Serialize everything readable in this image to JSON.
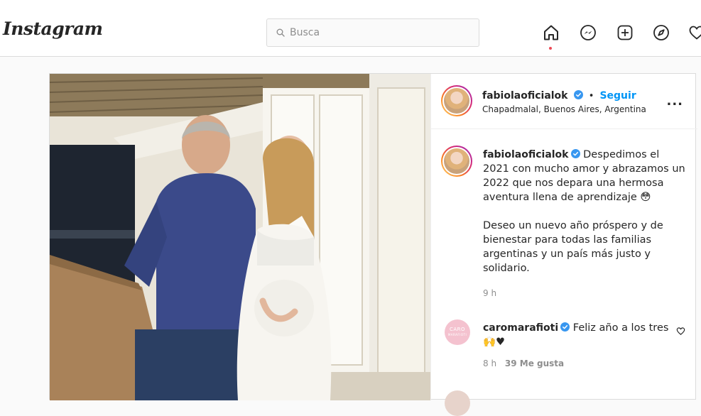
{
  "app": {
    "logo": "Instagram"
  },
  "search": {
    "placeholder": "Busca"
  },
  "nav": {
    "icons": [
      "home-icon",
      "messenger-icon",
      "new-post-icon",
      "explore-icon",
      "activity-heart-icon"
    ]
  },
  "post": {
    "author": {
      "username": "fabiolaoficialok",
      "separator": "•",
      "follow_label": "Seguir",
      "location": "Chapadmalal, Buenos Aires, Argentina"
    },
    "more_label": "...",
    "caption": {
      "username": "fabiolaoficialok",
      "paragraph1": "Despedimos el 2021 con mucho amor y abrazamos un 2022 que nos depara una hermosa aventura llena de aprendizaje 😳",
      "paragraph2": "Deseo un nuevo año próspero y de bienestar para todas las familias argentinas y un país más justo y solidario.",
      "time": "9 h"
    },
    "comments": [
      {
        "username": "caromarafioti",
        "avatar_text_top": "CARO",
        "avatar_text_bottom": "MARAFIOTI",
        "text": "Feliz año a los tres 🙌♥",
        "time": "8 h",
        "likes": "39 Me gusta"
      }
    ]
  },
  "colors": {
    "link_blue": "#0095f6",
    "verified_blue": "#3897f0",
    "notification_red": "#ed4956",
    "border": "#dbdbdb"
  }
}
